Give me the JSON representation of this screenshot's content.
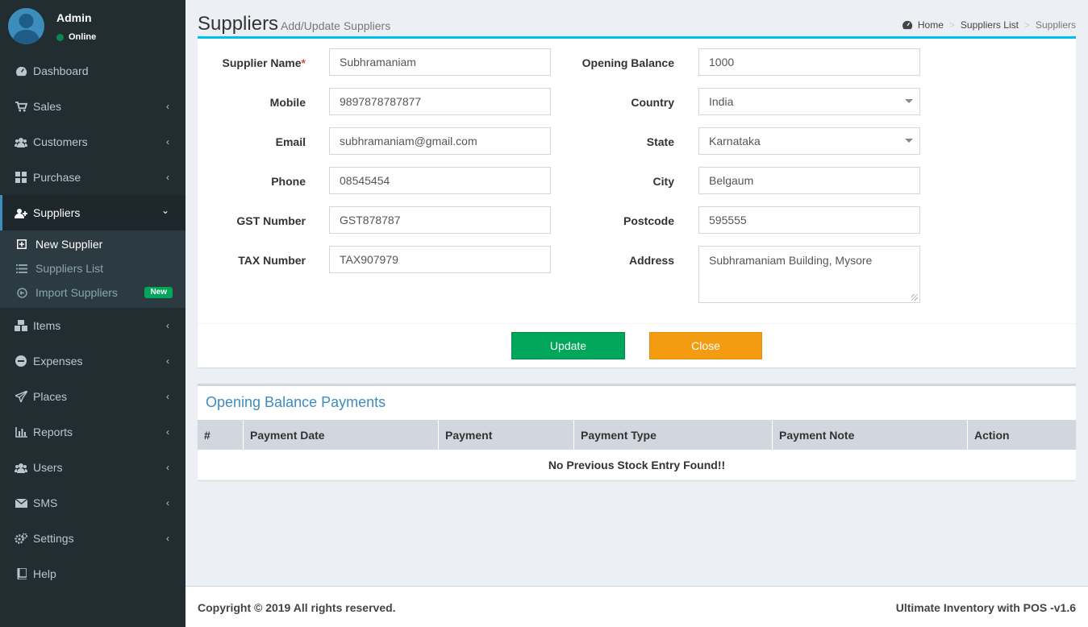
{
  "user": {
    "name": "Admin",
    "status": "Online"
  },
  "sidebar": {
    "items": [
      {
        "label": "Dashboard",
        "icon": "dashboard-icon"
      },
      {
        "label": "Sales",
        "icon": "cart-icon"
      },
      {
        "label": "Customers",
        "icon": "users-icon"
      },
      {
        "label": "Purchase",
        "icon": "grid-icon"
      },
      {
        "label": "Suppliers",
        "icon": "user-plus-icon"
      },
      {
        "label": "Items",
        "icon": "cubes-icon"
      },
      {
        "label": "Expenses",
        "icon": "minus-circle-icon"
      },
      {
        "label": "Places",
        "icon": "paper-plane-icon"
      },
      {
        "label": "Reports",
        "icon": "bar-chart-icon"
      },
      {
        "label": "Users",
        "icon": "users-icon"
      },
      {
        "label": "SMS",
        "icon": "envelope-icon"
      },
      {
        "label": "Settings",
        "icon": "cogs-icon"
      },
      {
        "label": "Help",
        "icon": "book-icon"
      }
    ],
    "suppliers_sub": [
      {
        "label": "New Supplier",
        "icon": "plus-square-icon"
      },
      {
        "label": "Suppliers List",
        "icon": "list-icon"
      },
      {
        "label": "Import Suppliers",
        "icon": "arrow-circle-icon",
        "badge": "New"
      }
    ]
  },
  "header": {
    "title": "Suppliers",
    "subtitle": "Add/Update Suppliers",
    "breadcrumb": [
      "Home",
      "Suppliers List",
      "Suppliers"
    ]
  },
  "form": {
    "supplier_name": {
      "label": "Supplier Name",
      "required_mark": "*",
      "value": "Subhramaniam"
    },
    "mobile": {
      "label": "Mobile",
      "value": "9897878787877"
    },
    "email": {
      "label": "Email",
      "value": "subhramaniam@gmail.com"
    },
    "phone": {
      "label": "Phone",
      "value": "08545454"
    },
    "gst": {
      "label": "GST Number",
      "value": "GST878787"
    },
    "tax": {
      "label": "TAX Number",
      "value": "TAX907979"
    },
    "opening_balance": {
      "label": "Opening Balance",
      "value": "1000"
    },
    "country": {
      "label": "Country",
      "value": "India"
    },
    "state": {
      "label": "State",
      "value": "Karnataka"
    },
    "city": {
      "label": "City",
      "value": "Belgaum"
    },
    "postcode": {
      "label": "Postcode",
      "value": "595555"
    },
    "address": {
      "label": "Address",
      "value": "Subhramaniam Building, Mysore"
    },
    "update_label": "Update",
    "close_label": "Close"
  },
  "payments": {
    "title": "Opening Balance Payments",
    "columns": [
      "#",
      "Payment Date",
      "Payment",
      "Payment Type",
      "Payment Note",
      "Action"
    ],
    "empty_text": "No Previous Stock Entry Found!!"
  },
  "footer": {
    "copyright": "Copyright © 2019 All rights reserved.",
    "version": "Ultimate Inventory with POS -v1.6"
  },
  "colors": {
    "sidebar_bg": "#222d32",
    "accent": "#00c0ef",
    "update_btn": "#00a65a",
    "close_btn": "#f39c12",
    "link_blue": "#3c8dbc"
  }
}
